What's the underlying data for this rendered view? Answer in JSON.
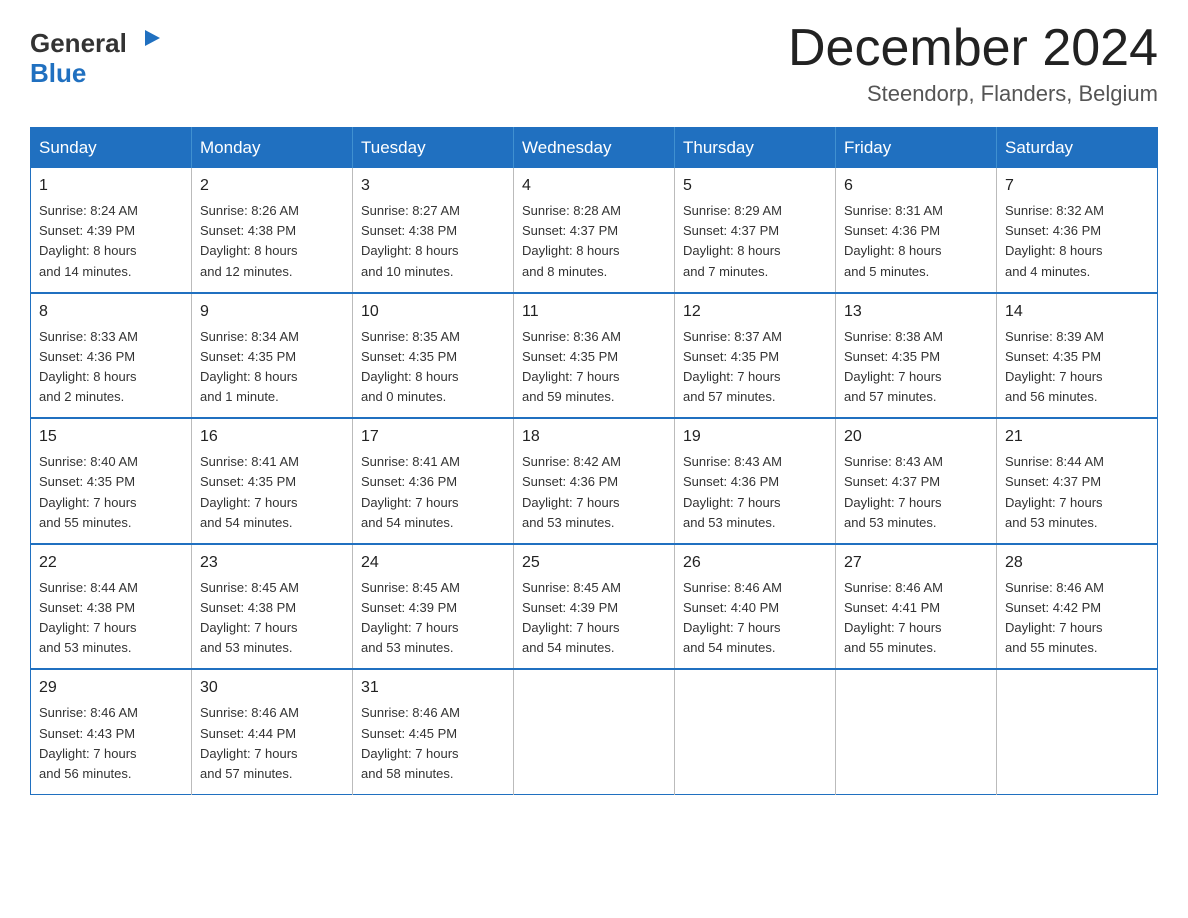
{
  "header": {
    "logo_line1": "General",
    "logo_line2": "Blue",
    "page_title": "December 2024",
    "page_subtitle": "Steendorp, Flanders, Belgium"
  },
  "calendar": {
    "days_of_week": [
      "Sunday",
      "Monday",
      "Tuesday",
      "Wednesday",
      "Thursday",
      "Friday",
      "Saturday"
    ],
    "weeks": [
      [
        {
          "day": "1",
          "info": "Sunrise: 8:24 AM\nSunset: 4:39 PM\nDaylight: 8 hours\nand 14 minutes."
        },
        {
          "day": "2",
          "info": "Sunrise: 8:26 AM\nSunset: 4:38 PM\nDaylight: 8 hours\nand 12 minutes."
        },
        {
          "day": "3",
          "info": "Sunrise: 8:27 AM\nSunset: 4:38 PM\nDaylight: 8 hours\nand 10 minutes."
        },
        {
          "day": "4",
          "info": "Sunrise: 8:28 AM\nSunset: 4:37 PM\nDaylight: 8 hours\nand 8 minutes."
        },
        {
          "day": "5",
          "info": "Sunrise: 8:29 AM\nSunset: 4:37 PM\nDaylight: 8 hours\nand 7 minutes."
        },
        {
          "day": "6",
          "info": "Sunrise: 8:31 AM\nSunset: 4:36 PM\nDaylight: 8 hours\nand 5 minutes."
        },
        {
          "day": "7",
          "info": "Sunrise: 8:32 AM\nSunset: 4:36 PM\nDaylight: 8 hours\nand 4 minutes."
        }
      ],
      [
        {
          "day": "8",
          "info": "Sunrise: 8:33 AM\nSunset: 4:36 PM\nDaylight: 8 hours\nand 2 minutes."
        },
        {
          "day": "9",
          "info": "Sunrise: 8:34 AM\nSunset: 4:35 PM\nDaylight: 8 hours\nand 1 minute."
        },
        {
          "day": "10",
          "info": "Sunrise: 8:35 AM\nSunset: 4:35 PM\nDaylight: 8 hours\nand 0 minutes."
        },
        {
          "day": "11",
          "info": "Sunrise: 8:36 AM\nSunset: 4:35 PM\nDaylight: 7 hours\nand 59 minutes."
        },
        {
          "day": "12",
          "info": "Sunrise: 8:37 AM\nSunset: 4:35 PM\nDaylight: 7 hours\nand 57 minutes."
        },
        {
          "day": "13",
          "info": "Sunrise: 8:38 AM\nSunset: 4:35 PM\nDaylight: 7 hours\nand 57 minutes."
        },
        {
          "day": "14",
          "info": "Sunrise: 8:39 AM\nSunset: 4:35 PM\nDaylight: 7 hours\nand 56 minutes."
        }
      ],
      [
        {
          "day": "15",
          "info": "Sunrise: 8:40 AM\nSunset: 4:35 PM\nDaylight: 7 hours\nand 55 minutes."
        },
        {
          "day": "16",
          "info": "Sunrise: 8:41 AM\nSunset: 4:35 PM\nDaylight: 7 hours\nand 54 minutes."
        },
        {
          "day": "17",
          "info": "Sunrise: 8:41 AM\nSunset: 4:36 PM\nDaylight: 7 hours\nand 54 minutes."
        },
        {
          "day": "18",
          "info": "Sunrise: 8:42 AM\nSunset: 4:36 PM\nDaylight: 7 hours\nand 53 minutes."
        },
        {
          "day": "19",
          "info": "Sunrise: 8:43 AM\nSunset: 4:36 PM\nDaylight: 7 hours\nand 53 minutes."
        },
        {
          "day": "20",
          "info": "Sunrise: 8:43 AM\nSunset: 4:37 PM\nDaylight: 7 hours\nand 53 minutes."
        },
        {
          "day": "21",
          "info": "Sunrise: 8:44 AM\nSunset: 4:37 PM\nDaylight: 7 hours\nand 53 minutes."
        }
      ],
      [
        {
          "day": "22",
          "info": "Sunrise: 8:44 AM\nSunset: 4:38 PM\nDaylight: 7 hours\nand 53 minutes."
        },
        {
          "day": "23",
          "info": "Sunrise: 8:45 AM\nSunset: 4:38 PM\nDaylight: 7 hours\nand 53 minutes."
        },
        {
          "day": "24",
          "info": "Sunrise: 8:45 AM\nSunset: 4:39 PM\nDaylight: 7 hours\nand 53 minutes."
        },
        {
          "day": "25",
          "info": "Sunrise: 8:45 AM\nSunset: 4:39 PM\nDaylight: 7 hours\nand 54 minutes."
        },
        {
          "day": "26",
          "info": "Sunrise: 8:46 AM\nSunset: 4:40 PM\nDaylight: 7 hours\nand 54 minutes."
        },
        {
          "day": "27",
          "info": "Sunrise: 8:46 AM\nSunset: 4:41 PM\nDaylight: 7 hours\nand 55 minutes."
        },
        {
          "day": "28",
          "info": "Sunrise: 8:46 AM\nSunset: 4:42 PM\nDaylight: 7 hours\nand 55 minutes."
        }
      ],
      [
        {
          "day": "29",
          "info": "Sunrise: 8:46 AM\nSunset: 4:43 PM\nDaylight: 7 hours\nand 56 minutes."
        },
        {
          "day": "30",
          "info": "Sunrise: 8:46 AM\nSunset: 4:44 PM\nDaylight: 7 hours\nand 57 minutes."
        },
        {
          "day": "31",
          "info": "Sunrise: 8:46 AM\nSunset: 4:45 PM\nDaylight: 7 hours\nand 58 minutes."
        },
        null,
        null,
        null,
        null
      ]
    ]
  }
}
